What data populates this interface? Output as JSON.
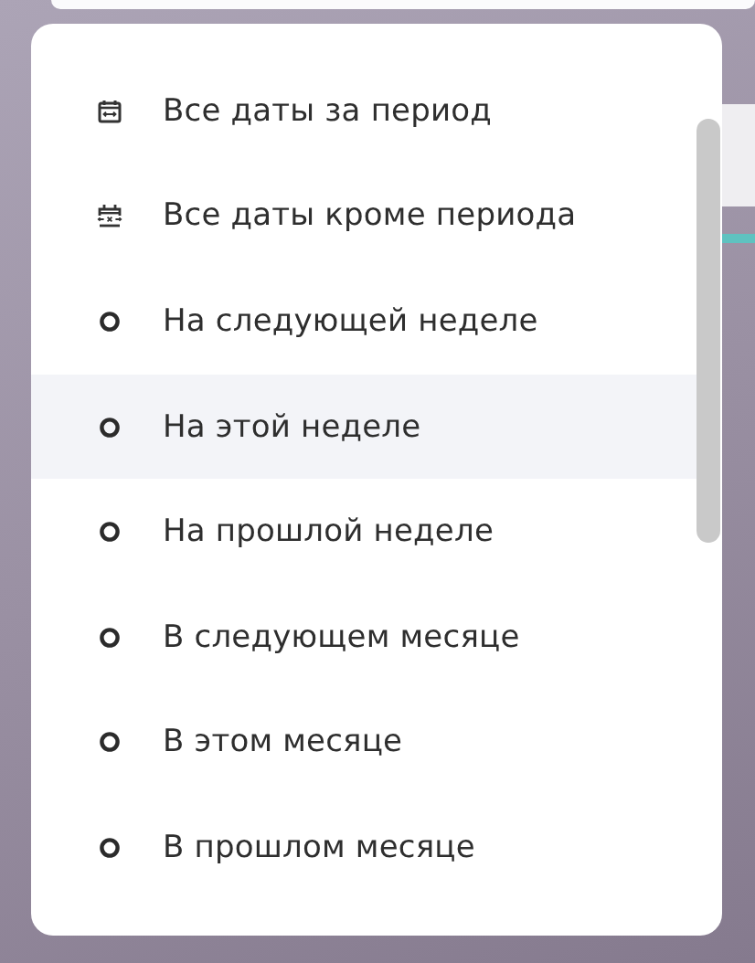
{
  "menu": {
    "items": [
      {
        "label": "Все даты за период",
        "kind": "range",
        "selected": false
      },
      {
        "label": "Все даты кроме периода",
        "kind": "exclude",
        "selected": false
      },
      {
        "label": "На следующей неделе",
        "kind": "preset",
        "selected": false
      },
      {
        "label": "На этой неделе",
        "kind": "preset",
        "selected": true
      },
      {
        "label": "На прошлой неделе",
        "kind": "preset",
        "selected": false
      },
      {
        "label": "В следующем месяце",
        "kind": "preset",
        "selected": false
      },
      {
        "label": "В этом месяце",
        "kind": "preset",
        "selected": false
      },
      {
        "label": "В прошлом месяце",
        "kind": "preset",
        "selected": false
      }
    ]
  }
}
